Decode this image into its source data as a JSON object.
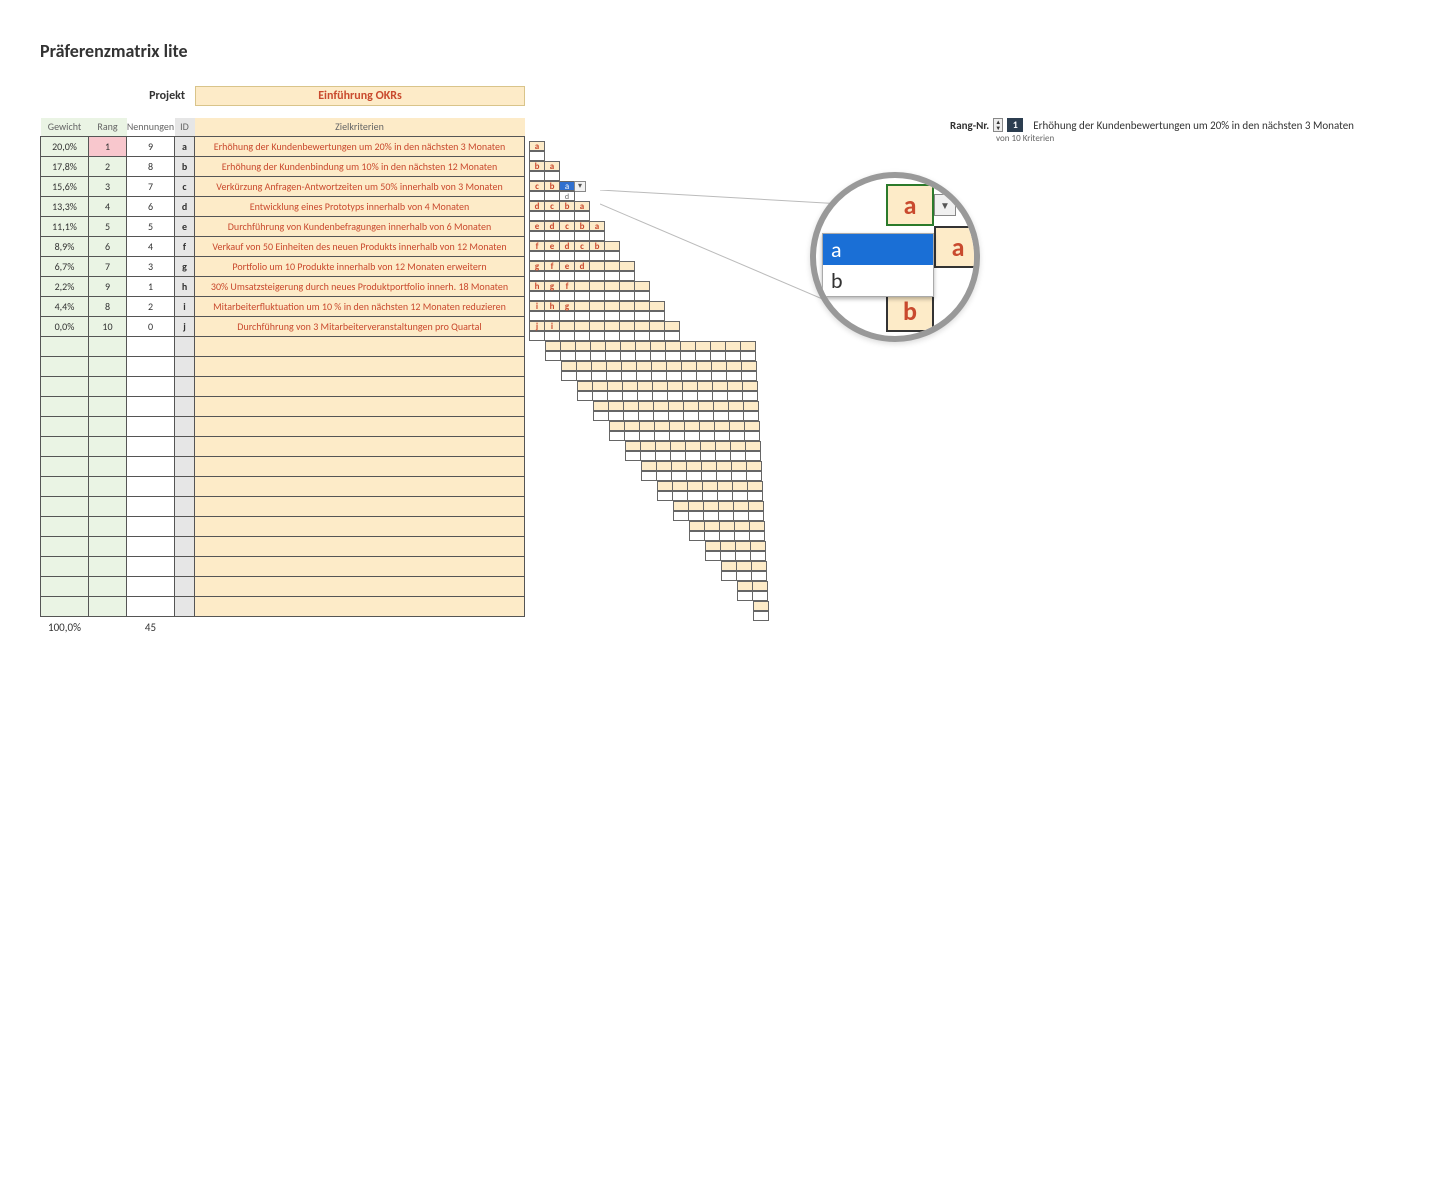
{
  "title": "Präferenzmatrix lite",
  "project": {
    "label": "Projekt",
    "value": "Einführung OKRs"
  },
  "headers": {
    "gewicht": "Gewicht",
    "rang": "Rang",
    "nennungen": "Nennungen",
    "id": "ID",
    "zielkriterien": "Zielkriterien"
  },
  "rows": [
    {
      "gewicht": "20,0%",
      "rang": "1",
      "nenn": "9",
      "id": "a",
      "ziel": "Erhöhung der Kundenbewertungen um 20% in den nächsten 3 Monaten",
      "top": true
    },
    {
      "gewicht": "17,8%",
      "rang": "2",
      "nenn": "8",
      "id": "b",
      "ziel": "Erhöhung der Kundenbindung um 10% in den nächsten 12 Monaten"
    },
    {
      "gewicht": "15,6%",
      "rang": "3",
      "nenn": "7",
      "id": "c",
      "ziel": "Verkürzung Anfragen-Antwortzeiten um 50% innerhalb von 3 Monaten"
    },
    {
      "gewicht": "13,3%",
      "rang": "4",
      "nenn": "6",
      "id": "d",
      "ziel": "Entwicklung eines Prototyps innerhalb von 4 Monaten"
    },
    {
      "gewicht": "11,1%",
      "rang": "5",
      "nenn": "5",
      "id": "e",
      "ziel": "Durchführung von Kundenbefragungen innerhalb von 6 Monaten"
    },
    {
      "gewicht": "8,9%",
      "rang": "6",
      "nenn": "4",
      "id": "f",
      "ziel": "Verkauf von 50 Einheiten des neuen Produkts innerhalb von 12 Monaten"
    },
    {
      "gewicht": "6,7%",
      "rang": "7",
      "nenn": "3",
      "id": "g",
      "ziel": "Portfolio um 10 Produkte innerhalb von 12 Monaten erweitern"
    },
    {
      "gewicht": "2,2%",
      "rang": "9",
      "nenn": "1",
      "id": "h",
      "ziel": "30% Umsatzsteigerung durch neues Produktportfolio innerh. 18 Monaten"
    },
    {
      "gewicht": "4,4%",
      "rang": "8",
      "nenn": "2",
      "id": "i",
      "ziel": "Mitarbeiterfluktuation um 10 % in den nächsten 12 Monaten reduzieren"
    },
    {
      "gewicht": "0,0%",
      "rang": "10",
      "nenn": "0",
      "id": "j",
      "ziel": "Durchführung von 3 Mitarbeiterveranstaltungen pro Quartal"
    }
  ],
  "empty_rows": 14,
  "totals": {
    "gewicht": "100,0%",
    "nenn": "45"
  },
  "matrix": {
    "rows": [
      [
        "a"
      ],
      [
        "b",
        "a"
      ],
      [
        "c",
        "b",
        "a"
      ],
      [
        "d",
        "c",
        "b",
        "a"
      ],
      [
        "e",
        "d",
        "c",
        "b",
        "a"
      ],
      [
        "f",
        "e",
        "d",
        "c",
        "b"
      ],
      [
        "g",
        "f",
        "e",
        "d"
      ],
      [
        "h",
        "g",
        "f"
      ],
      [
        "i",
        "h",
        "g"
      ],
      [
        "j",
        "i"
      ]
    ],
    "dropdown": {
      "selected": "a",
      "below_label": "d",
      "open_row": 2,
      "options": [
        "a",
        "b"
      ]
    }
  },
  "rank_panel": {
    "label": "Rang-Nr.",
    "num": "1",
    "desc": "Erhöhung der Kundenbewertungen um 20% in den nächsten 3 Monaten",
    "sub": {
      "prefix": "von",
      "count": "10",
      "suffix": "Kriterien"
    }
  },
  "magnifier": {
    "big_a": "a",
    "big_a2": "a",
    "big_b": "b",
    "opt_a": "a",
    "opt_b": "b"
  }
}
